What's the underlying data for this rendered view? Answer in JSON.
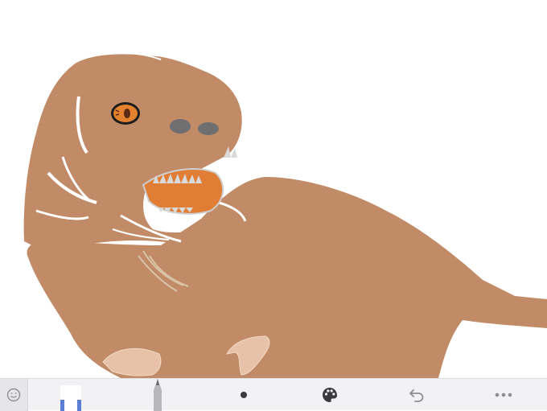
{
  "app": {
    "screen": "sketch-canvas"
  },
  "colors": {
    "canvas_background": "#ffffff",
    "dino_body": "#c08b66",
    "eye_orange": "#e3812f",
    "mouth_orange": "#e07e36",
    "teeth": "#d9d9d9",
    "nostril_gray": "#6f6f70",
    "claw": "#e8c2a8",
    "toolbar_bg": "#f2f2f4",
    "tool_accent": "#5b7fd6"
  },
  "toolbar": {
    "tools": [
      {
        "name": "emoji",
        "icon": "smiley-icon"
      },
      {
        "name": "marker",
        "icon": "marker-icon",
        "selected": true
      },
      {
        "name": "pencil",
        "icon": "pencil-icon"
      },
      {
        "name": "brush-size",
        "icon": "dot-icon"
      },
      {
        "name": "color-palette",
        "icon": "palette-icon"
      },
      {
        "name": "undo",
        "icon": "undo-icon"
      },
      {
        "name": "more",
        "icon": "more-icon"
      }
    ]
  }
}
